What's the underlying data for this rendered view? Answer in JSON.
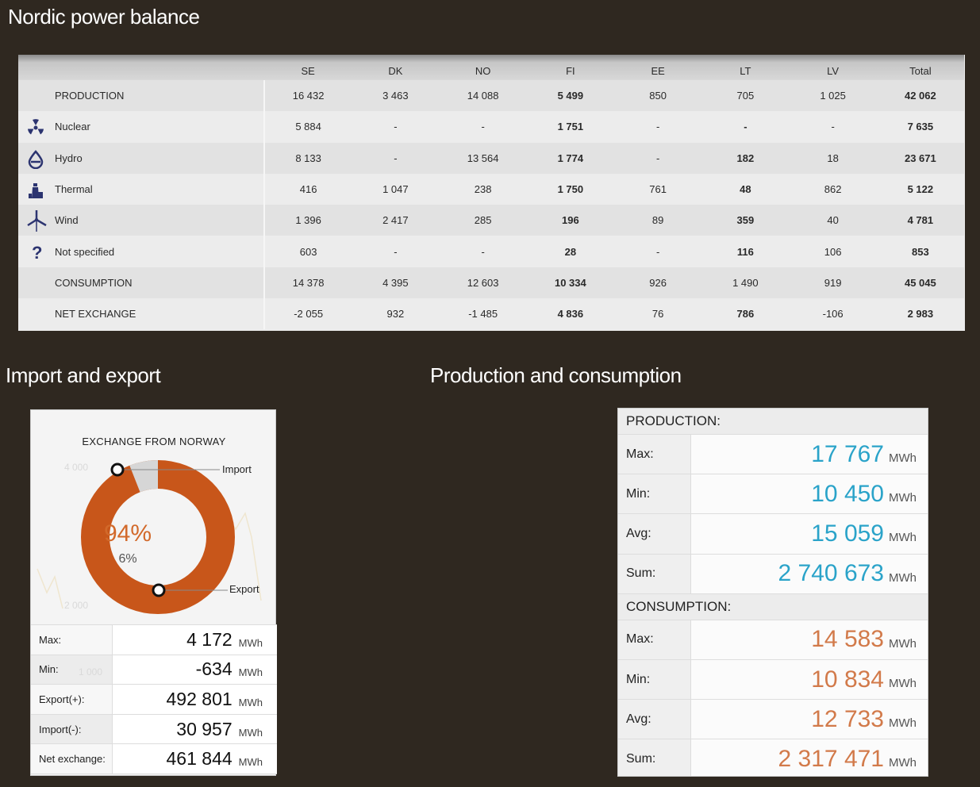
{
  "page_title": "Nordic power balance",
  "balance": {
    "columns": [
      "",
      "SE",
      "DK",
      "NO",
      "FI",
      "EE",
      "LT",
      "LV",
      "Total"
    ],
    "rows": [
      {
        "label": "PRODUCTION",
        "icon": "",
        "values": [
          "16 432",
          "3 463",
          "14 088",
          "5 499",
          "850",
          "705",
          "1 025",
          "42 062"
        ]
      },
      {
        "label": "Nuclear",
        "icon": "nuclear-icon",
        "values": [
          "5 884",
          "-",
          "-",
          "1 751",
          "-",
          "-",
          "-",
          "7 635"
        ]
      },
      {
        "label": "Hydro",
        "icon": "hydro-drop-icon",
        "values": [
          "8 133",
          "-",
          "13 564",
          "1 774",
          "-",
          "182",
          "18",
          "23 671"
        ]
      },
      {
        "label": "Thermal",
        "icon": "thermal-plant-icon",
        "values": [
          "416",
          "1 047",
          "238",
          "1 750",
          "761",
          "48",
          "862",
          "5 122"
        ]
      },
      {
        "label": "Wind",
        "icon": "wind-turbine-icon",
        "values": [
          "1 396",
          "2 417",
          "285",
          "196",
          "89",
          "359",
          "40",
          "4 781"
        ]
      },
      {
        "label": "Not specified",
        "icon": "question-icon",
        "values": [
          "603",
          "-",
          "-",
          "28",
          "-",
          "116",
          "106",
          "853"
        ]
      },
      {
        "label": "CONSUMPTION",
        "icon": "",
        "values": [
          "14 378",
          "4 395",
          "12 603",
          "10 334",
          "926",
          "1 490",
          "919",
          "45 045"
        ]
      },
      {
        "label": "NET EXCHANGE",
        "icon": "",
        "values": [
          "-2 055",
          "932",
          "-1 485",
          "4 836",
          "76",
          "786",
          "-106",
          "2 983"
        ]
      }
    ]
  },
  "import_export": {
    "heading": "Import and export",
    "chart_title": "EXCHANGE FROM NORWAY",
    "export_pct": "94%",
    "import_pct": "6%",
    "import_label": "Import",
    "export_label": "Export",
    "bg_ticks": [
      "4 000",
      "2 000",
      "1 000"
    ],
    "colors": {
      "export": "#c8561a",
      "import": "#d6d6d6"
    },
    "stats": [
      {
        "key": "Max:",
        "value": "4 172",
        "unit": "MWh"
      },
      {
        "key": "Min:",
        "value": "-634",
        "unit": "MWh"
      },
      {
        "key": "Export(+):",
        "value": "492 801",
        "unit": "MWh"
      },
      {
        "key": "Import(-):",
        "value": "30 957",
        "unit": "MWh"
      },
      {
        "key": "Net exchange:",
        "value": "461 844",
        "unit": "MWh"
      }
    ]
  },
  "prod_cons": {
    "heading": "Production and consumption",
    "production_label": "PRODUCTION:",
    "production": [
      {
        "key": "Max:",
        "value": "17 767",
        "unit": "MWh"
      },
      {
        "key": "Min:",
        "value": "10 450",
        "unit": "MWh"
      },
      {
        "key": "Avg:",
        "value": "15 059",
        "unit": "MWh"
      },
      {
        "key": "Sum:",
        "value": "2 740 673",
        "unit": "MWh"
      }
    ],
    "consumption_label": "CONSUMPTION:",
    "consumption": [
      {
        "key": "Max:",
        "value": "14 583",
        "unit": "MWh"
      },
      {
        "key": "Min:",
        "value": "10 834",
        "unit": "MWh"
      },
      {
        "key": "Avg:",
        "value": "12 733",
        "unit": "MWh"
      },
      {
        "key": "Sum:",
        "value": "2 317 471",
        "unit": "MWh"
      }
    ],
    "colors": {
      "production": "#2aa3c9",
      "consumption": "#d27a4a"
    }
  }
}
